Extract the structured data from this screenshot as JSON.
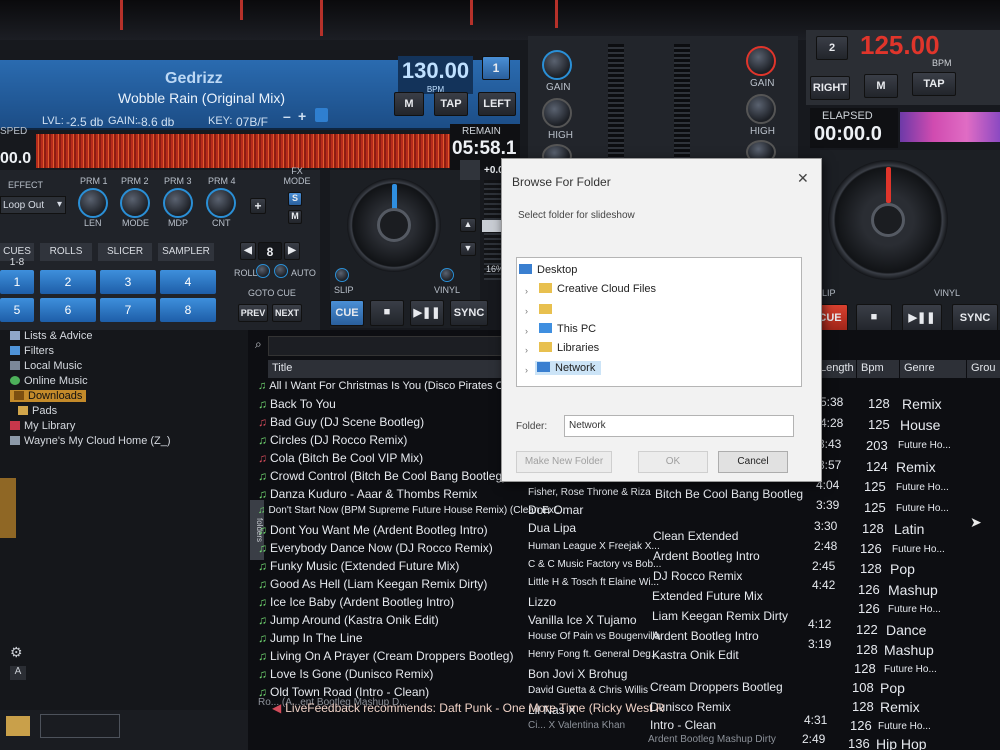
{
  "left_deck": {
    "artist": "Gedrizz",
    "song": "Wobble Rain (Original Mix)",
    "level_label": "LVL:",
    "level_value": "-2.5 db",
    "gain_label": "GAIN:",
    "gain_value": "-8.6 db",
    "key_label": "KEY:",
    "key_value": "07B/F",
    "bpm": "130.00",
    "bpm_label": "BPM",
    "m_label": "M",
    "tap_label": "TAP",
    "side_label": "LEFT",
    "speed_label": "SPED",
    "speed_value": "00.0",
    "remain_label": "REMAIN",
    "remain_value": "05:58.1",
    "pitch_value": "+0.0",
    "pitch_range": "16%",
    "cue_label": "CUE",
    "sync_label": "SYNC",
    "slip_label": "SLIP",
    "vinyl_label": "VINYL"
  },
  "effects": {
    "effect_label": "EFFECT",
    "effect_value": "Loop Out",
    "prm_labels": [
      "PRM 1",
      "PRM 2",
      "PRM 3",
      "PRM 4"
    ],
    "knob_labels": [
      "LEN",
      "MODE",
      "MDP",
      "CNT"
    ],
    "fx_mode_label": "FX MODE",
    "fx_s": "S",
    "fx_m": "M",
    "tabs": [
      "CUES 1-8",
      "ROLLS",
      "SLICER",
      "SAMPLER"
    ],
    "loop_value": "8",
    "roll_label": "ROLL",
    "auto_label": "AUTO",
    "goto_cue_label": "GOTO CUE",
    "prev_label": "PREV",
    "next_label": "NEXT",
    "pads": [
      "1",
      "2",
      "3",
      "4",
      "5",
      "6",
      "7",
      "8"
    ]
  },
  "mixer": {
    "gain_label": "GAIN",
    "high_label": "HIGH"
  },
  "right_deck": {
    "deck_number": "2",
    "bpm": "125.00",
    "bpm_label": "BPM",
    "side_label": "RIGHT",
    "m_label": "M",
    "tap_label": "TAP",
    "elapsed_label": "ELAPSED",
    "elapsed_value": "00:00.0",
    "cue_label": "CUE",
    "sync_label": "SYNC",
    "slip_label": "SLIP",
    "vinyl_label": "VINYL"
  },
  "sidebar": {
    "items": [
      "Lists & Advice",
      "Filters",
      "Local Music",
      "Online Music",
      "Downloads",
      "Pads",
      "My Library",
      "Wayne's My Cloud Home (Z_)"
    ],
    "selected": "Downloads",
    "folders_tab": "folders"
  },
  "table": {
    "headers": {
      "title": "Title",
      "length": "Length",
      "bpm": "Bpm",
      "genre": "Genre",
      "group": "Grou"
    },
    "titles": [
      "All I Want For Christmas Is You (Disco Pirates Club",
      "Back To You",
      "Bad Guy (DJ Scene Bootleg)",
      "Circles (DJ Rocco Remix)",
      "Cola (Bitch Be Cool VIP Mix)",
      "Crowd Control (Bitch Be Cool Bang Bootleg)",
      "Danza Kuduro - Aaar & Thombs Remix",
      "Don't Start Now (BPM Supreme Future House Remix) (Clean Ext...",
      "Dont You Want Me (Ardent Bootleg Intro)",
      "Everybody Dance Now (DJ Rocco Remix)",
      "Funky Music (Extended Future Mix)",
      "Good As Hell (Liam Keegan Remix Dirty)",
      "Ice Ice Baby (Ardent Bootleg Intro)",
      "Jump Around (Kastra Onik Edit)",
      "Jump In The Line",
      "Living On A Prayer (Cream Droppers Bootleg)",
      "Love Is Gone (Dunisco Remix)",
      "Old Town Road (Intro - Clean)"
    ],
    "artists": [
      "Fisher, Rose Throne & Riza",
      "Don Omar",
      "Dua Lipa",
      "Human League X Freejak X...",
      "C & C Music Factory vs Bob...",
      "Little H & Tosch ft Elaine Wi...",
      "Lizzo",
      "Vanilla Ice X Tujamo",
      "House Of Pain vs Bougenvilla",
      "Henry Fong ft. General Deg...",
      "Bon Jovi X Brohug",
      "David Guetta & Chris Willis",
      "Lil Nas X"
    ],
    "remixes": [
      "Bitch Be Cool Bang Bootleg",
      "Clean Extended",
      "Ardent Bootleg Intro",
      "DJ Rocco Remix",
      "Extended Future Mix",
      "Liam Keegan Remix Dirty",
      "Ardent Bootleg Intro",
      "Kastra Onik Edit",
      "Cream Droppers Bootleg",
      "Dunisco Remix",
      "Intro - Clean"
    ],
    "lengths": [
      "5:38",
      "4:28",
      "3:43",
      "3:57",
      "4:04",
      "3:39",
      "3:30",
      "2:48",
      "2:45",
      "4:42",
      "4:12",
      "3:19",
      "4:31",
      "2:49"
    ],
    "bpms": [
      "128",
      "125",
      "203",
      "124",
      "125",
      "125",
      "128",
      "126",
      "128",
      "126",
      "126",
      "122",
      "128",
      "128",
      "108",
      "128",
      "126",
      "136"
    ],
    "genres": [
      "Remix",
      "House",
      "Future Ho...",
      "Remix",
      "Future Ho...",
      "Future Ho...",
      "Latin",
      "Future Ho...",
      "Pop",
      "Mashup",
      "Future Ho...",
      "Dance",
      "Mashup",
      "Future Ho...",
      "Pop",
      "Remix",
      "Future Ho...",
      "Hip Hop"
    ],
    "partial_bottom_title": "Ro... (A...ent Bootleg Mashup D...",
    "partial_bottom_artist": "Ci... X Valentina Khan",
    "partial_bottom_remix": "Ardent Bootleg Mashup Dirty"
  },
  "recommend": {
    "text": "LiveFeedback recommends: Daft Punk - One More Time (Ricky West R"
  },
  "dialog": {
    "title": "Browse For Folder",
    "close_glyph": "✕",
    "description": "Select folder for slideshow",
    "tree": [
      "Desktop",
      "Creative Cloud Files",
      "",
      "This PC",
      "Libraries",
      "Network"
    ],
    "selected": "Network",
    "folder_label": "Folder:",
    "folder_value": "Network",
    "make_new_folder": "Make New Folder",
    "ok": "OK",
    "cancel": "Cancel"
  },
  "colors": {
    "deck_blue": "#2a6bb0",
    "cue_red": "#d9412f",
    "waveform_red": "#b52b1c",
    "bpm_red": "#e0352b",
    "selection_orange": "#c38a2a",
    "dialog_selection": "#cce4f7"
  }
}
